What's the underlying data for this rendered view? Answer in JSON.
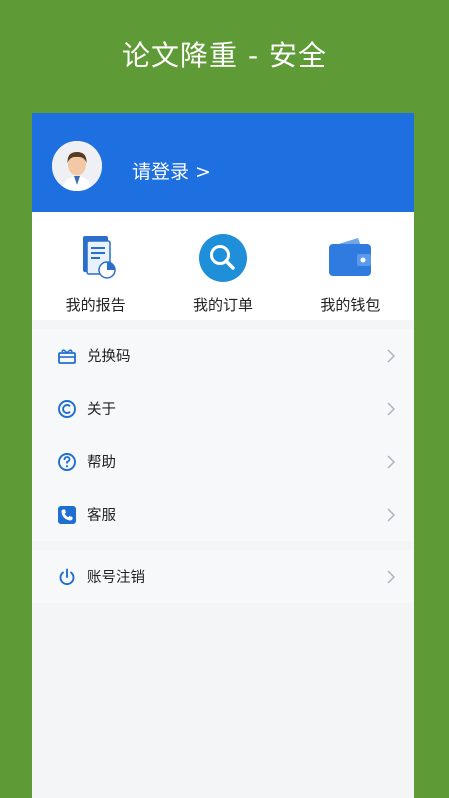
{
  "banner": {
    "title": "论文降重 - 安全"
  },
  "header": {
    "login_label": "请登录 >"
  },
  "quick_actions": [
    {
      "label": "我的报告",
      "icon": "report-icon"
    },
    {
      "label": "我的订单",
      "icon": "search-icon"
    },
    {
      "label": "我的钱包",
      "icon": "wallet-icon"
    }
  ],
  "menu": [
    {
      "label": "兑换码",
      "icon": "gift-icon"
    },
    {
      "label": "关于",
      "icon": "copyright-icon"
    },
    {
      "label": "帮助",
      "icon": "question-icon"
    },
    {
      "label": "客服",
      "icon": "phone-icon"
    }
  ],
  "menu2": [
    {
      "label": "账号注销",
      "icon": "power-icon"
    }
  ],
  "colors": {
    "background": "#5e9a35",
    "header": "#1e6fe0",
    "icon_blue": "#1f6fd0"
  }
}
